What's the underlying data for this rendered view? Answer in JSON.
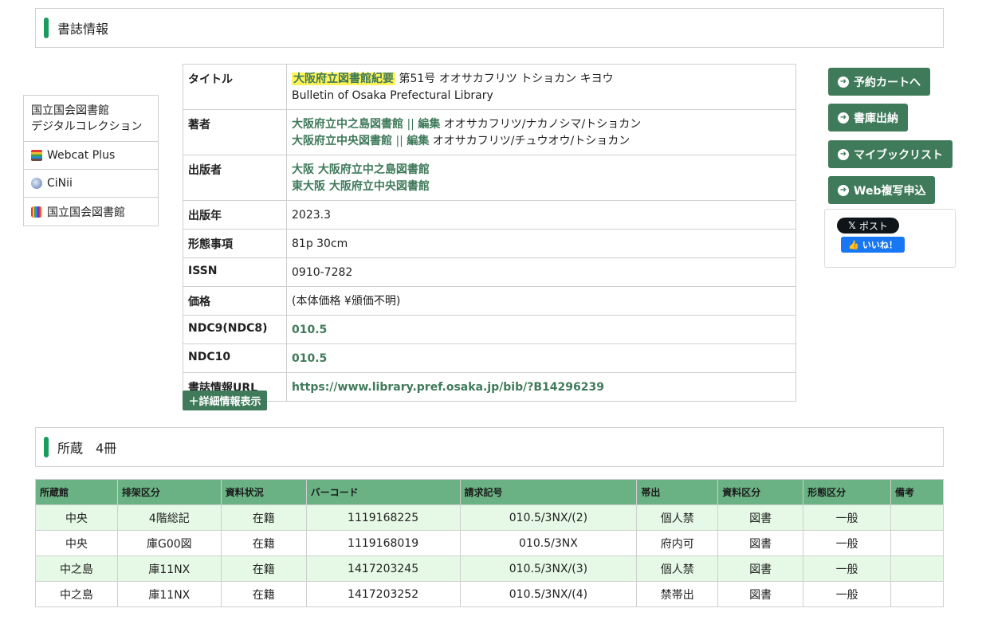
{
  "sections": {
    "biblio_title": "書誌情報",
    "holdings_title": "所蔵　4冊"
  },
  "left_links": [
    {
      "label1": "国立国会図書館",
      "label2": "デジタルコレクション"
    },
    {
      "label": "Webcat Plus"
    },
    {
      "label": "CiNii"
    },
    {
      "label": "国立国会図書館"
    }
  ],
  "biblio": {
    "title_key": "タイトル",
    "title_main": "大阪府立図書館紀要",
    "title_rest": "第51号 オオサカフリツ トショカン キヨウ",
    "title_en": "Bulletin of Osaka Prefectural Library",
    "author_key": "著者",
    "author1_name": "大阪府立中之島図書館",
    "author1_sep": "||",
    "author1_role": "編集",
    "author1_kana": "オオサカフリツ/ナカノシマ/トショカン",
    "author2_name": "大阪府立中央図書館",
    "author2_sep": "||",
    "author2_role": "編集",
    "author2_kana": "オオサカフリツ/チュウオウ/トショカン",
    "publisher_key": "出版者",
    "publisher1": "大阪 大阪府立中之島図書館",
    "publisher2": "東大阪 大阪府立中央図書館",
    "year_key": "出版年",
    "year": "2023.3",
    "form_key": "形態事項",
    "form": "81p 30cm",
    "issn_key": "ISSN",
    "issn": "0910-7282",
    "price_key": "価格",
    "price": "(本体価格 ¥頒価不明)",
    "ndc9_key": "NDC9(NDC8)",
    "ndc9": "010.5",
    "ndc10_key": "NDC10",
    "ndc10": "010.5",
    "url_key": "書誌情報URL",
    "url": "https://www.library.pref.osaka.jp/bib/?B14296239"
  },
  "detail_button": "＋詳細情報表示",
  "actions": {
    "reserve": "予約カートへ",
    "stack": "書庫出納",
    "mybook": "マイブックリスト",
    "webcopy": "Web複写申込",
    "x_post": "ポスト",
    "fb_like": "いいね！"
  },
  "holdings": {
    "headers": [
      "所蔵館",
      "排架区分",
      "資料状況",
      "バーコード",
      "請求記号",
      "帯出",
      "資料区分",
      "形態区分",
      "備考"
    ],
    "rows": [
      [
        "中央",
        "4階総記",
        "在籍",
        "1119168225",
        "010.5/3NX/(2)",
        "個人禁",
        "図書",
        "一般",
        ""
      ],
      [
        "中央",
        "庫G00図",
        "在籍",
        "1119168019",
        "010.5/3NX",
        "府内可",
        "図書",
        "一般",
        ""
      ],
      [
        "中之島",
        "庫11NX",
        "在籍",
        "1417203245",
        "010.5/3NX/(3)",
        "個人禁",
        "図書",
        "一般",
        ""
      ],
      [
        "中之島",
        "庫11NX",
        "在籍",
        "1417203252",
        "010.5/3NX/(4)",
        "禁帯出",
        "図書",
        "一般",
        ""
      ]
    ]
  }
}
